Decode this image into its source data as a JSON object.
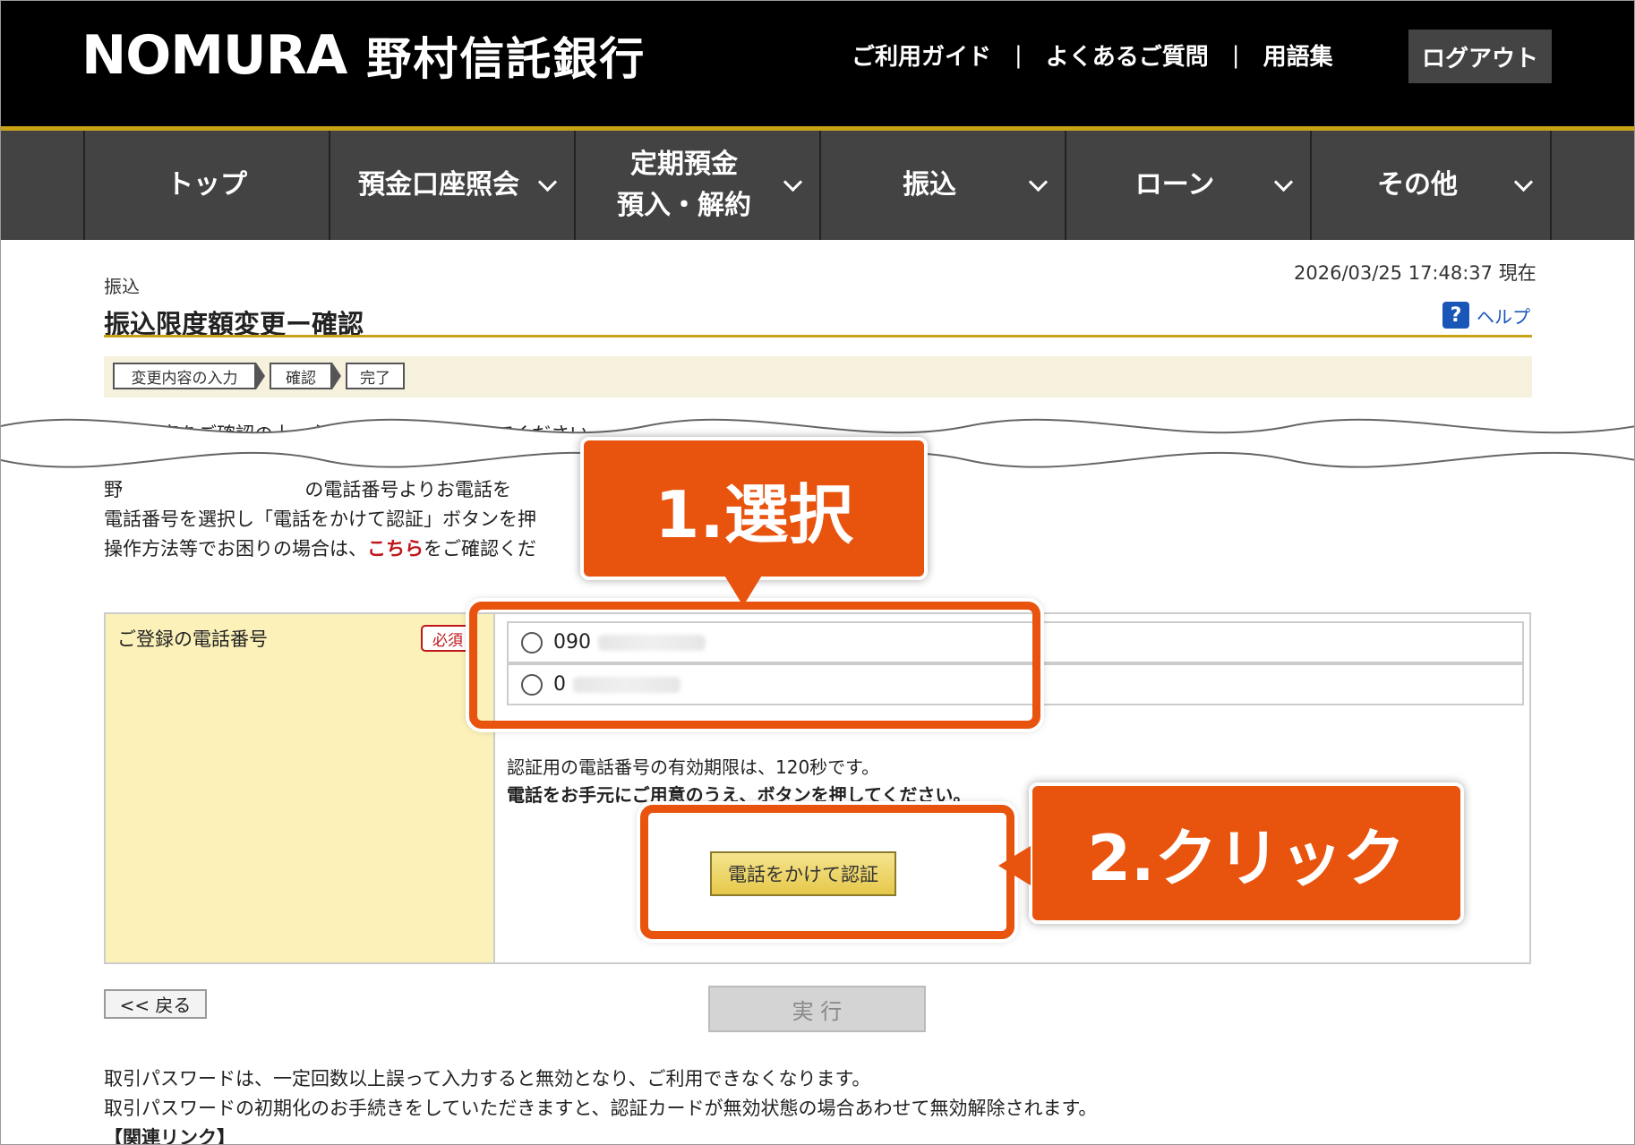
{
  "header": {
    "logo_en": "NOMURA",
    "logo_jp": "野村信託銀行",
    "links": [
      "ご利用ガイド",
      "よくあるご質問",
      "用語集"
    ],
    "logout": "ログアウト"
  },
  "nav": {
    "items": [
      {
        "label": "トップ"
      },
      {
        "label": "預金口座照会"
      },
      {
        "label_line1": "定期預金",
        "label_line2": "預入・解約"
      },
      {
        "label": "振込"
      },
      {
        "label": "ローン"
      },
      {
        "label": "その他"
      }
    ]
  },
  "page": {
    "breadcrumb": "振込",
    "title": "振込限度額変更ー確認",
    "datetime": "2026/03/25  17:48:37 現在",
    "help": "ヘルプ",
    "help_icon": "?",
    "steps": [
      "変更内容の入力",
      "確認",
      "完了"
    ],
    "intro": "変更内容をご確認の上、必",
    "intro_tail": "く入力してください。",
    "para1": "野",
    "para1_mid": "の電話番号よりお電話を",
    "para2": "電話番号を選択し「電話をかけて認証」ボタンを押",
    "para3_pre": "操作方法等でお困りの場合は、",
    "para3_link": "こちら",
    "para3_post": "をご確認くだ"
  },
  "form": {
    "label": "ご登録の電話番号",
    "required": "必須",
    "phones": [
      "090",
      "0"
    ],
    "note1": "認証用の電話番号の有効期限は、120秒です。",
    "note2": "電話をお手元にご用意のうえ、ボタンを押してください。",
    "call_button": "電話をかけて認証"
  },
  "buttons": {
    "back": "<< 戻る",
    "execute": "実 行"
  },
  "footer": {
    "line1": "取引パスワードは、一定回数以上誤って入力すると無効となり、ご利用できなくなります。",
    "line2": "取引パスワードの初期化のお手続きをしていただきますと、認証カードが無効状態の場合あわせて無効解除されます。",
    "line3": "【関連リンク】"
  },
  "annotations": {
    "step1": "1.選択",
    "step2": "2.クリック"
  },
  "colors": {
    "accent": "#e8530e",
    "gold": "#c8a318",
    "nav_bg": "#434343"
  }
}
